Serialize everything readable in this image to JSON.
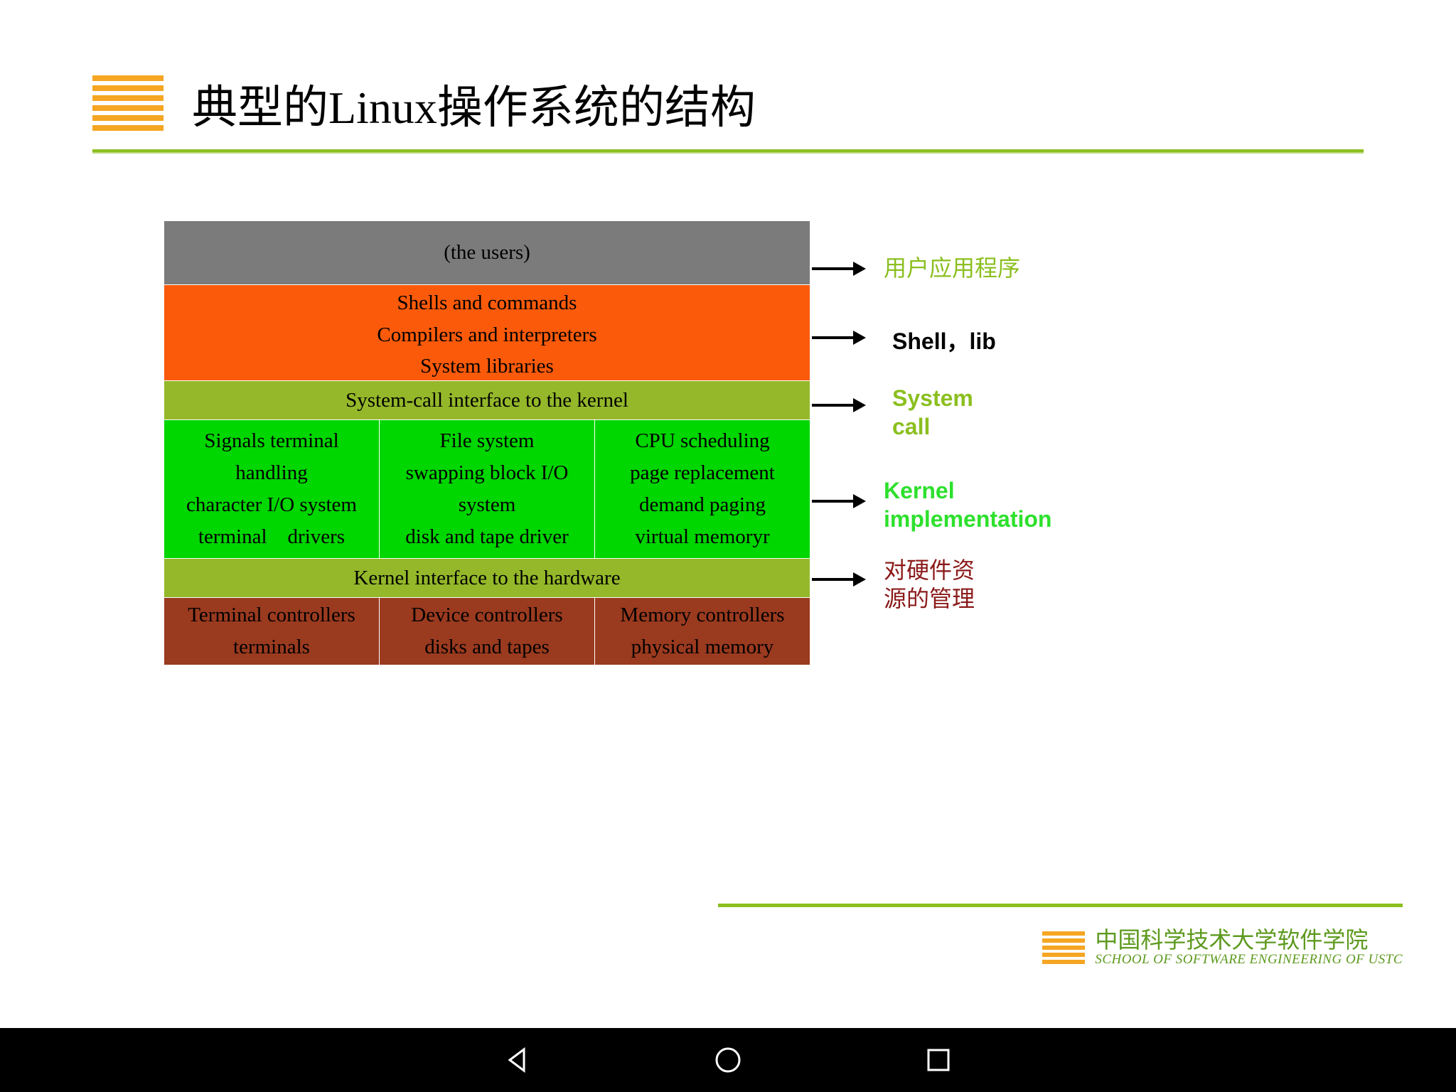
{
  "title": "典型的Linux操作系统的结构",
  "layers": {
    "users": "(the users)",
    "shell": {
      "l1": "Shells and commands",
      "l2": "Compilers and interpreters",
      "l3": "System libraries"
    },
    "syscall": "System-call interface to the kernel",
    "kernel": {
      "col1": {
        "l1": "Signals terminal",
        "l2": "handling",
        "l3": "character I/O system",
        "l4": "terminal drivers"
      },
      "col2": {
        "l1": "File system",
        "l2": "swapping block I/O",
        "l3": "system",
        "l4": "disk and tape driver"
      },
      "col3": {
        "l1": "CPU scheduling",
        "l2": "page replacement",
        "l3": "demand paging",
        "l4": "virtual memoryr"
      }
    },
    "hwiface": "Kernel interface to the hardware",
    "hw": {
      "col1": {
        "l1": "Terminal controllers",
        "l2": "terminals"
      },
      "col2": {
        "l1": "Device controllers",
        "l2": "disks and tapes"
      },
      "col3": {
        "l1": "Memory controllers",
        "l2": "physical memory"
      }
    }
  },
  "annotations": {
    "user": "用户应用程序",
    "shell": "Shell，lib",
    "syscall_l1": "System",
    "syscall_l2": "call",
    "kernel_l1": "Kernel",
    "kernel_l2": "implementation",
    "hw_l1": "对硬件资",
    "hw_l2": "源的管理"
  },
  "footer": {
    "cn": "中国科学技术大学软件学院",
    "en": "SCHOOL OF SOFTWARE ENGINEERING OF USTC"
  }
}
